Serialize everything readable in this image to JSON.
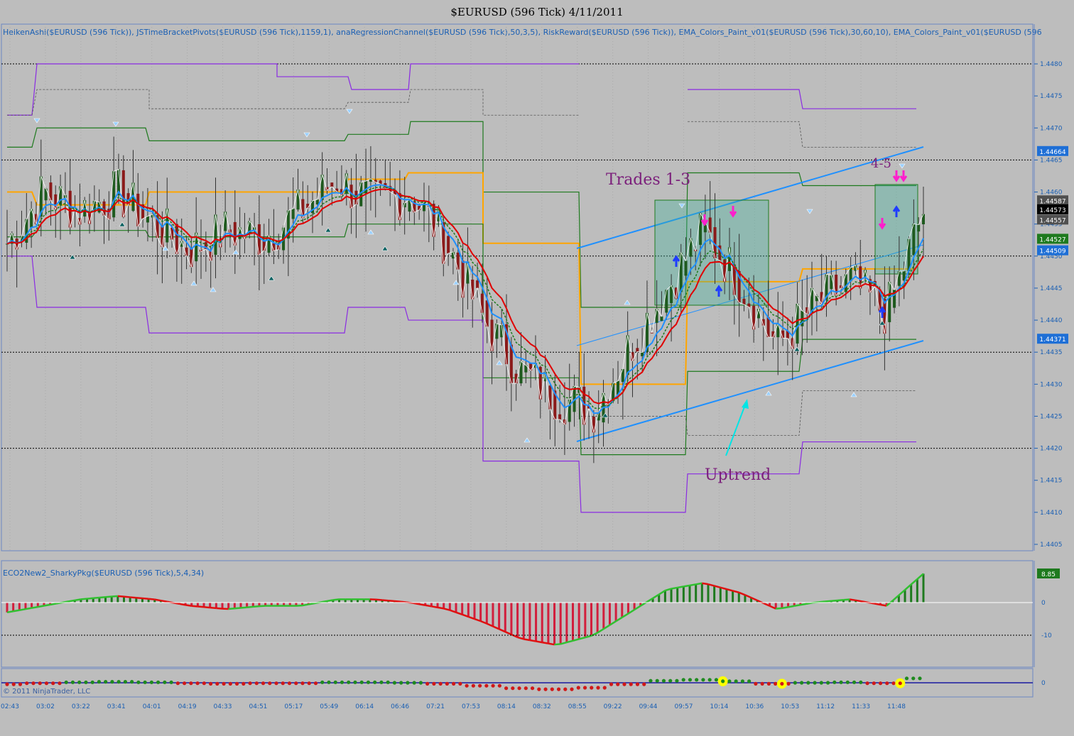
{
  "window": {
    "title": "$EURUSD (596 Tick)  4/11/2011",
    "indicator_caption": "HeikenAshi($EURUSD (596 Tick)), JSTimeBracketPivots($EURUSD (596 Tick),1159,1), anaRegressionChannel($EURUSD (596 Tick),50,3,5), RiskReward($EURUSD (596 Tick)), EMA_Colors_Paint_v01($EURUSD (596 Tick),30,60,10), EMA_Colors_Paint_v01($EURUSD (596"
  },
  "colors": {
    "background": "#bdbdbd",
    "panel_bg": "#bdbdbd",
    "axis_text": "#1a5fb4",
    "grid": "#a9a9a9",
    "candle_up": "#1e5a1e",
    "candle_down": "#8b1a1a",
    "ema_fast": "#1e90ff",
    "ema_slow": "#e00000",
    "pivot_purple": "#8a2be2",
    "pivot_green": "#1e7a1e",
    "pivot_orange": "#ffa500",
    "channel": "#1e90ff",
    "trade_box": "#3cb39a",
    "annotation": "#7b1f7b",
    "arrow_cyan": "#00e5e5",
    "osc_up": "#1e7a1e",
    "osc_down": "#d21e3c",
    "dot_yellow": "#ffff00"
  },
  "annotations": {
    "trades_label": "Trades 1-3",
    "trades45_label": "4-5",
    "uptrend_label": "Uptrend"
  },
  "price_axis": {
    "ticks": [
      "1.4480",
      "1.4475",
      "1.4470",
      "1.4465",
      "1.4460",
      "1.4455",
      "1.4450",
      "1.4445",
      "1.4440",
      "1.4435",
      "1.4430",
      "1.4425",
      "1.4420",
      "1.4415",
      "1.4410",
      "1.4405"
    ],
    "badges": [
      {
        "label": "1.44664",
        "price": 1.44664,
        "color": "#1e6fd6"
      },
      {
        "label": "1.44587",
        "price": 1.44587,
        "color": "#505050"
      },
      {
        "label": "1.44573",
        "price": 1.44573,
        "color": "#000000"
      },
      {
        "label": "1.44557",
        "price": 1.44557,
        "color": "#505050"
      },
      {
        "label": "1.44527",
        "price": 1.44527,
        "color": "#1e7a1e"
      },
      {
        "label": "1.44509",
        "price": 1.44509,
        "color": "#1e6fd6"
      },
      {
        "label": "1.44371",
        "price": 1.44371,
        "color": "#1e6fd6"
      }
    ]
  },
  "oscillator": {
    "caption": "ECO2New2_SharkyPkg($EURUSD (596 Tick),5,4,34)",
    "badge": "8.85",
    "ticks": [
      "0",
      "-10"
    ]
  },
  "bottom_panel": {
    "caption": "(obscured indicator caption)",
    "copyright": "© 2011 NinjaTrader, LLC",
    "tick": "0"
  },
  "time_axis": {
    "labels": [
      "02:43",
      "03:02",
      "03:22",
      "03:41",
      "04:01",
      "04:19",
      "04:33",
      "04:51",
      "05:17",
      "05:49",
      "06:14",
      "06:46",
      "07:21",
      "07:53",
      "08:14",
      "08:32",
      "08:55",
      "09:22",
      "09:44",
      "09:57",
      "10:14",
      "10:36",
      "10:53",
      "11:12",
      "11:33",
      "11:48"
    ]
  },
  "chart_data": {
    "type": "candlestick",
    "title": "$EURUSD (596 Tick)  4/11/2011",
    "ylim": [
      1.4403,
      1.4483
    ],
    "x": [
      "02:43",
      "03:02",
      "03:22",
      "03:41",
      "04:01",
      "04:19",
      "04:33",
      "04:51",
      "05:17",
      "05:49",
      "06:14",
      "06:46",
      "07:21",
      "07:53",
      "08:14",
      "08:32",
      "08:55",
      "09:22",
      "09:44",
      "09:57",
      "10:14",
      "10:36",
      "10:53",
      "11:12",
      "11:33",
      "11:48"
    ],
    "close_trend": [
      1.4452,
      1.446,
      1.4457,
      1.446,
      1.4455,
      1.4451,
      1.4454,
      1.4453,
      1.4457,
      1.4462,
      1.4458,
      1.446,
      1.4452,
      1.444,
      1.4432,
      1.4428,
      1.4426,
      1.4436,
      1.4445,
      1.4454,
      1.4446,
      1.4436,
      1.4442,
      1.4446,
      1.4441,
      1.4457
    ],
    "oscillator_values": [
      -3,
      -1,
      1,
      2,
      1,
      -1,
      -2,
      -1,
      -1,
      1,
      1,
      0,
      -2,
      -6,
      -11,
      -13,
      -10,
      -3,
      4,
      6,
      3,
      -2,
      0,
      1,
      -1,
      8.85
    ]
  }
}
